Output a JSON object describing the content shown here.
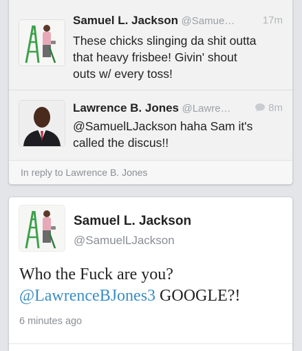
{
  "thread": {
    "tweets": [
      {
        "name": "Samuel L. Jackson",
        "handle": "@Samue…",
        "time": "17m",
        "text_lines": [
          "These chicks slinging da shit outta",
          "that heavy frisbee! Givin' shout",
          "outs w/ every toss!"
        ]
      },
      {
        "name": "Lawrence B. Jones",
        "handle": "@Lawre…",
        "time": "8m",
        "text_lines": [
          "@SamuelLJackson haha Sam it's",
          "called the discus!!"
        ]
      }
    ],
    "reply_label": "In reply to Lawrence B. Jones"
  },
  "main_tweet": {
    "name": "Samuel L. Jackson",
    "handle": "@SamuelLJackson",
    "text_line1": "Who the Fuck are you?",
    "mention": "@LawrenceBJones3",
    "text_line2_rest": " GOOGLE?!",
    "timestamp": "6 minutes ago"
  },
  "icons": {
    "avatar_samuel": "person-on-ladder-avatar",
    "avatar_lawrence": "man-in-suit-avatar",
    "reply_bubble": "speech-bubble-icon"
  },
  "colors": {
    "mention": "#3a8dc4",
    "muted_text": "#8a8e94"
  }
}
